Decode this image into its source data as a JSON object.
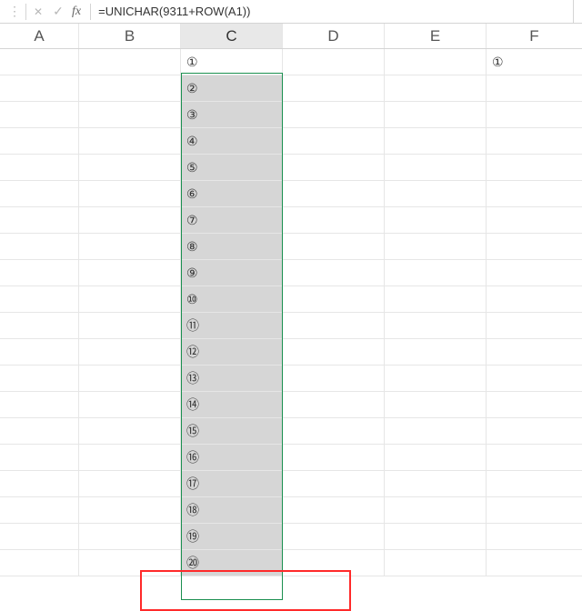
{
  "formula_bar": {
    "dots": "⋮",
    "cancel": "✕",
    "confirm": "✓",
    "fx": "fx",
    "formula": "=UNICHAR(9311+ROW(A1))"
  },
  "columns": [
    "A",
    "B",
    "C",
    "D",
    "E",
    "F"
  ],
  "selected_col": "C",
  "col_c_values": [
    "①",
    "②",
    "③",
    "④",
    "⑤",
    "⑥",
    "⑦",
    "⑧",
    "⑨",
    "⑩",
    "⑪",
    "⑫",
    "⑬",
    "⑭",
    "⑮",
    "⑯",
    "⑰",
    "⑱",
    "⑲",
    "⑳"
  ],
  "f1_value": "①"
}
